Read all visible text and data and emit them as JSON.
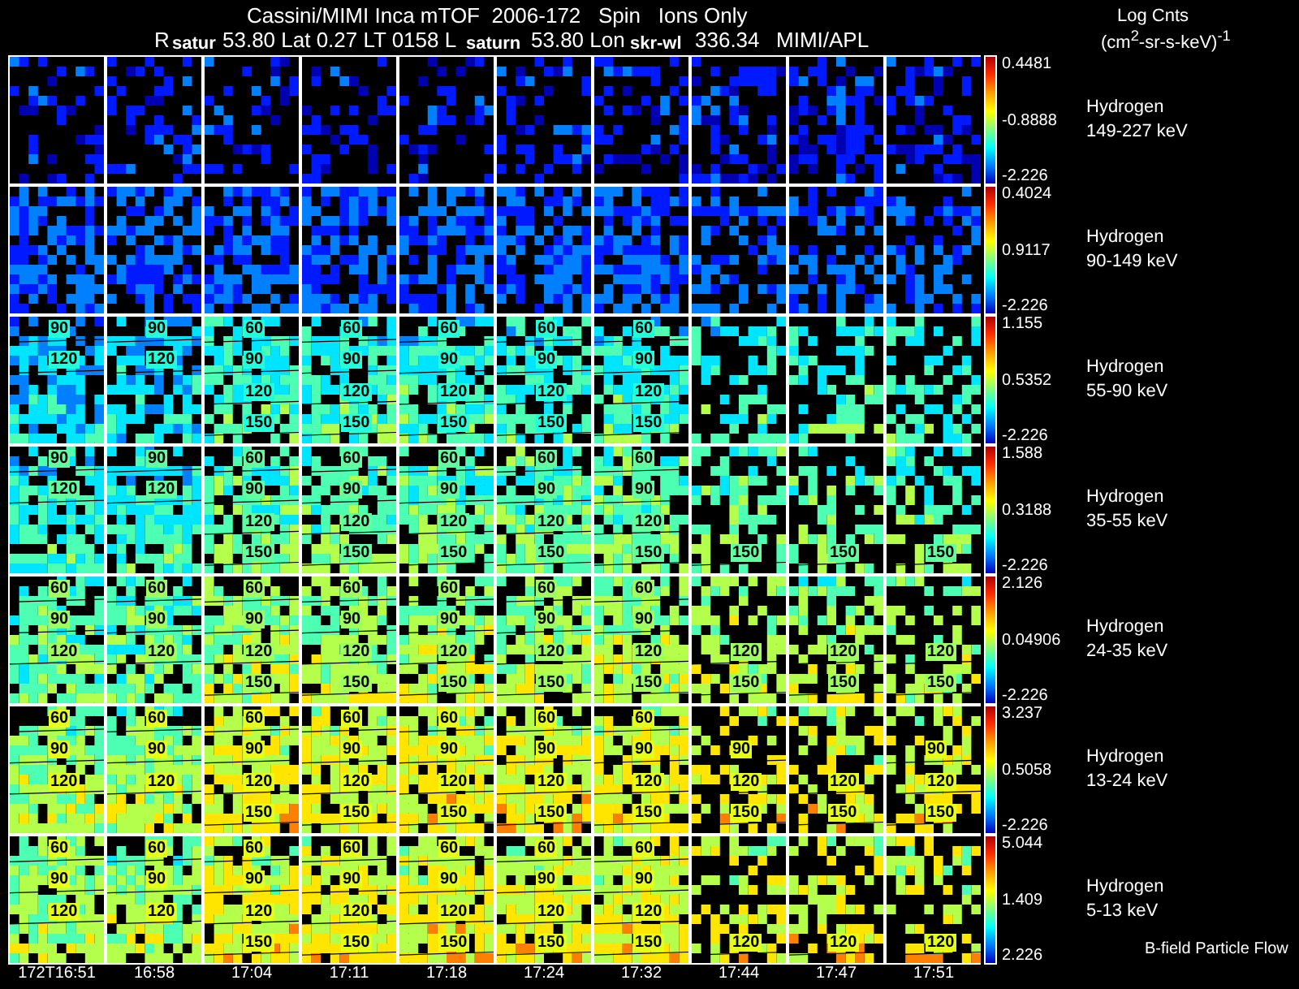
{
  "title": "Cassini/MIMI Inca mTOF  2006-172   Spin   Ions Only",
  "subtitle": [
    "R",
    "53.80 Lat 0.27 LT 0158 L",
    "53.80 Lon",
    "336.34",
    "MIMI/APL"
  ],
  "units": {
    "label": "Log Cnts",
    "formula": "(cm$^{2}$-sr-s-keV)$^{-1}$"
  },
  "markers": [
    "satur",
    "saturn",
    "skr-wl"
  ],
  "panels": [
    {
      "species": "Hydrogen",
      "energy": "149-227 keV",
      "scale": [
        "0.4481",
        "-0.8888",
        "-2.226"
      ],
      "cells": [
        {
          "kind": "plain"
        },
        {
          "kind": "plain"
        },
        {
          "kind": "plain"
        },
        {
          "kind": "plain"
        },
        {
          "kind": "plain"
        },
        {
          "kind": "plain"
        },
        {
          "kind": "plain"
        },
        {
          "kind": "plain"
        },
        {
          "kind": "plain"
        },
        {
          "kind": "plain"
        }
      ]
    },
    {
      "species": "Hydrogen",
      "energy": "90-149 keV",
      "scale": [
        "0.4024",
        "0.9117",
        "-2.226"
      ],
      "cells": [
        {
          "kind": "plain"
        },
        {
          "kind": "plain"
        },
        {
          "kind": "plain"
        },
        {
          "kind": "plain"
        },
        {
          "kind": "plain"
        },
        {
          "kind": "plain"
        },
        {
          "kind": "plain"
        },
        {
          "kind": "plain"
        },
        {
          "kind": "plain"
        },
        {
          "kind": "plain"
        }
      ]
    },
    {
      "species": "Hydrogen",
      "energy": "55-90 keV",
      "scale": [
        "1.155",
        "0.5352",
        "-2.226"
      ],
      "cells": [
        {
          "kind": "contoured",
          "labels": [
            "90",
            "120"
          ]
        },
        {
          "kind": "contoured",
          "labels": [
            "90",
            "120"
          ]
        },
        {
          "kind": "contoured",
          "labels": [
            "60",
            "90",
            "120",
            "150"
          ]
        },
        {
          "kind": "contoured",
          "labels": [
            "60",
            "90",
            "120",
            "150"
          ]
        },
        {
          "kind": "contoured",
          "labels": [
            "60",
            "90",
            "120",
            "150"
          ]
        },
        {
          "kind": "contoured",
          "labels": [
            "60",
            "90",
            "120",
            "150"
          ]
        },
        {
          "kind": "contoured",
          "labels": [
            "60",
            "90",
            "120",
            "150"
          ]
        },
        {
          "kind": "plain"
        },
        {
          "kind": "plain"
        },
        {
          "kind": "plain"
        }
      ]
    },
    {
      "species": "Hydrogen",
      "energy": "35-55 keV",
      "scale": [
        "1.588",
        "0.3188",
        "-2.226"
      ],
      "cells": [
        {
          "kind": "contoured",
          "labels": [
            "90",
            "120"
          ]
        },
        {
          "kind": "contoured",
          "labels": [
            "90",
            "120"
          ]
        },
        {
          "kind": "contoured",
          "labels": [
            "60",
            "90",
            "120",
            "150"
          ]
        },
        {
          "kind": "contoured",
          "labels": [
            "60",
            "90",
            "120",
            "150"
          ]
        },
        {
          "kind": "contoured",
          "labels": [
            "60",
            "90",
            "120",
            "150"
          ]
        },
        {
          "kind": "contoured",
          "labels": [
            "60",
            "90",
            "120",
            "150"
          ]
        },
        {
          "kind": "contoured",
          "labels": [
            "60",
            "90",
            "120",
            "150"
          ]
        },
        {
          "kind": "contoured",
          "labels": [
            "150"
          ]
        },
        {
          "kind": "contoured",
          "labels": [
            "150"
          ]
        },
        {
          "kind": "contoured",
          "labels": [
            "150"
          ]
        }
      ]
    },
    {
      "species": "Hydrogen",
      "energy": "24-35 keV",
      "scale": [
        "2.126",
        "0.04906",
        "-2.226"
      ],
      "cells": [
        {
          "kind": "contoured",
          "labels": [
            "60",
            "90",
            "120"
          ]
        },
        {
          "kind": "contoured",
          "labels": [
            "60",
            "90",
            "120"
          ]
        },
        {
          "kind": "contoured",
          "labels": [
            "60",
            "90",
            "120",
            "150"
          ]
        },
        {
          "kind": "contoured",
          "labels": [
            "60",
            "90",
            "120",
            "150"
          ]
        },
        {
          "kind": "contoured",
          "labels": [
            "60",
            "90",
            "120",
            "150"
          ]
        },
        {
          "kind": "contoured",
          "labels": [
            "60",
            "90",
            "120",
            "150"
          ]
        },
        {
          "kind": "contoured",
          "labels": [
            "60",
            "90",
            "120",
            "150"
          ]
        },
        {
          "kind": "contoured",
          "labels": [
            "120",
            "150"
          ]
        },
        {
          "kind": "contoured",
          "labels": [
            "120",
            "150"
          ]
        },
        {
          "kind": "contoured",
          "labels": [
            "120",
            "150"
          ]
        }
      ]
    },
    {
      "species": "Hydrogen",
      "energy": "13-24 keV",
      "scale": [
        "3.237",
        "0.5058",
        "-2.226"
      ],
      "cells": [
        {
          "kind": "contoured",
          "labels": [
            "60",
            "90",
            "120"
          ]
        },
        {
          "kind": "contoured",
          "labels": [
            "60",
            "90",
            "120"
          ]
        },
        {
          "kind": "contoured",
          "labels": [
            "60",
            "90",
            "120",
            "150"
          ]
        },
        {
          "kind": "contoured",
          "labels": [
            "60",
            "90",
            "120",
            "150"
          ]
        },
        {
          "kind": "contoured",
          "labels": [
            "60",
            "90",
            "120",
            "150"
          ]
        },
        {
          "kind": "contoured",
          "labels": [
            "60",
            "90",
            "120",
            "150"
          ]
        },
        {
          "kind": "contoured",
          "labels": [
            "60",
            "90",
            "120",
            "150"
          ]
        },
        {
          "kind": "contoured",
          "labels": [
            "90",
            "120",
            "150"
          ]
        },
        {
          "kind": "contoured",
          "labels": [
            "120",
            "150"
          ]
        },
        {
          "kind": "contoured",
          "labels": [
            "90",
            "120",
            "150"
          ]
        }
      ]
    },
    {
      "species": "Hydrogen",
      "energy": "5-13 keV",
      "scale": [
        "5.044",
        "1.409",
        "2.226"
      ],
      "cells": [
        {
          "kind": "contoured",
          "labels": [
            "60",
            "90",
            "120"
          ]
        },
        {
          "kind": "contoured",
          "labels": [
            "60",
            "90",
            "120"
          ]
        },
        {
          "kind": "contoured",
          "labels": [
            "60",
            "90",
            "120",
            "150"
          ]
        },
        {
          "kind": "contoured",
          "labels": [
            "60",
            "90",
            "120",
            "150"
          ]
        },
        {
          "kind": "contoured",
          "labels": [
            "60",
            "90",
            "120",
            "150"
          ]
        },
        {
          "kind": "contoured",
          "labels": [
            "60",
            "90",
            "120",
            "150"
          ]
        },
        {
          "kind": "contoured",
          "labels": [
            "60",
            "90",
            "120",
            "150"
          ]
        },
        {
          "kind": "contoured",
          "labels": [
            "120"
          ]
        },
        {
          "kind": "contoured",
          "labels": [
            "120"
          ]
        },
        {
          "kind": "contoured",
          "labels": [
            "120"
          ]
        }
      ]
    }
  ],
  "times": [
    "172T16:51",
    "16:58",
    "17:04",
    "17:11",
    "17:18",
    "17:24",
    "17:32",
    "17:44",
    "17:47",
    "17:51"
  ],
  "footer_note": "B-field Particle Flow"
}
